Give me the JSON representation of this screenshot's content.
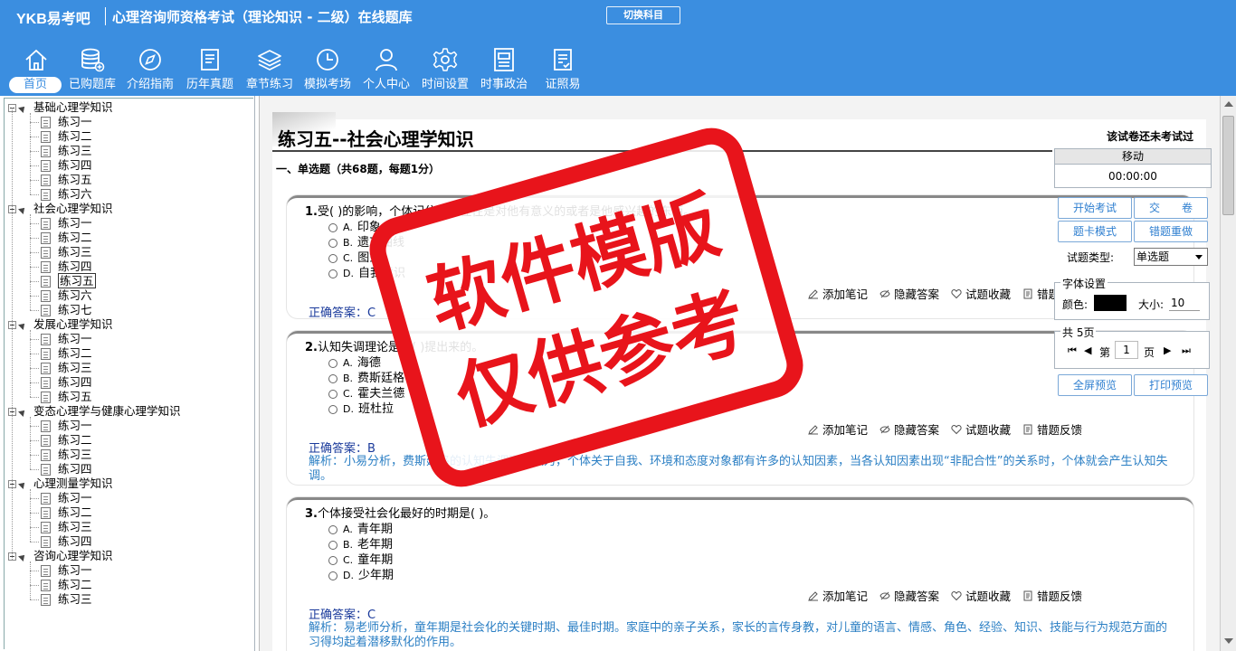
{
  "header": {
    "brand": "YKB易考吧",
    "title": "心理咨询师资格考试（理论知识 - 二级）在线题库",
    "switch_label": "切换科目"
  },
  "nav": [
    {
      "label": "首页",
      "icon": "home-icon",
      "active": true
    },
    {
      "label": "已购题库",
      "icon": "database-icon"
    },
    {
      "label": "介绍指南",
      "icon": "compass-icon"
    },
    {
      "label": "历年真题",
      "icon": "doc-list-icon"
    },
    {
      "label": "章节练习",
      "icon": "layers-icon"
    },
    {
      "label": "模拟考场",
      "icon": "clock-icon"
    },
    {
      "label": "个人中心",
      "icon": "user-icon"
    },
    {
      "label": "时间设置",
      "icon": "gear-icon"
    },
    {
      "label": "时事政治",
      "icon": "news-icon"
    },
    {
      "label": "证照易",
      "icon": "checklist-icon"
    }
  ],
  "tree": [
    {
      "label": "基础心理学知识",
      "children": [
        "练习一",
        "练习二",
        "练习三",
        "练习四",
        "练习五",
        "练习六"
      ]
    },
    {
      "label": "社会心理学知识",
      "children": [
        "练习一",
        "练习二",
        "练习三",
        "练习四",
        "练习五",
        "练习六",
        "练习七"
      ],
      "selected": 4
    },
    {
      "label": "发展心理学知识",
      "children": [
        "练习一",
        "练习二",
        "练习三",
        "练习四",
        "练习五"
      ]
    },
    {
      "label": "变态心理学与健康心理学知识",
      "children": [
        "练习一",
        "练习二",
        "练习三",
        "练习四"
      ]
    },
    {
      "label": "心理测量学知识",
      "children": [
        "练习一",
        "练习二",
        "练习三",
        "练习四"
      ]
    },
    {
      "label": "咨询心理学知识",
      "children": [
        "练习一",
        "练习二",
        "练习三"
      ]
    }
  ],
  "exam": {
    "title": "练习五--社会心理学知识",
    "status": "该试卷还未考试过",
    "section": "一、单选题（共68题，每题1分）"
  },
  "questions": [
    {
      "num": "1.",
      "stem": "受( )的影响，个体记住的，往往是对他有意义的或者是他感兴趣的东西。",
      "options": [
        {
          "letter": "A.",
          "text": "印象"
        },
        {
          "letter": "B.",
          "text": "遗忘曲线"
        },
        {
          "letter": "C.",
          "text": "图式"
        },
        {
          "letter": "D.",
          "text": "自我意识"
        }
      ],
      "answer_label": "正确答案：",
      "answer": "C",
      "analysis": ""
    },
    {
      "num": "2.",
      "stem": "认知失调理论是由( )提出来的。",
      "options": [
        {
          "letter": "A.",
          "text": "海德"
        },
        {
          "letter": "B.",
          "text": "费斯廷格"
        },
        {
          "letter": "C.",
          "text": "霍夫兰德"
        },
        {
          "letter": "D.",
          "text": "班杜拉"
        }
      ],
      "answer_label": "正确答案：",
      "answer": "B",
      "analysis": "解析：小易分析，费斯廷格的认知失调理论认为，个体关于自我、环境和态度对象都有许多的认知因素，当各认知因素出现“非配合性”的关系时，个体就会产生认知失调。"
    },
    {
      "num": "3.",
      "stem": "个体接受社会化最好的时期是( )。",
      "options": [
        {
          "letter": "A.",
          "text": "青年期"
        },
        {
          "letter": "B.",
          "text": "老年期"
        },
        {
          "letter": "C.",
          "text": "童年期"
        },
        {
          "letter": "D.",
          "text": "少年期"
        }
      ],
      "answer_label": "正确答案：",
      "answer": "C",
      "analysis": "解析：易老师分析，童年期是社会化的关键时期、最佳时期。家庭中的亲子关系，家长的言传身教，对儿童的语言、情感、角色、经验、知识、技能与行为规范方面的习得均起着潜移默化的作用。"
    }
  ],
  "tools": {
    "note": "添加笔记",
    "hide": "隐藏答案",
    "fav": "试题收藏",
    "report": "错题反馈"
  },
  "panel": {
    "move": "移动",
    "timer": "00:00:00",
    "start": "开始考试",
    "submit": "交　　卷",
    "card_mode": "题卡模式",
    "redo_wrong": "错题重做",
    "type_label": "试题类型:",
    "type_value": "单选题",
    "font_legend": "字体设置",
    "color_label": "颜色:",
    "size_label": "大小:",
    "size_value": "10",
    "pages_legend": "共 5页",
    "page_prefix": "第",
    "page_value": "1",
    "page_suffix": "页",
    "fullscreen": "全屏预览",
    "print": "打印预览"
  },
  "stamp": {
    "line1": "软件模版",
    "line2": "仅供参考",
    "color": "#e8141b"
  }
}
